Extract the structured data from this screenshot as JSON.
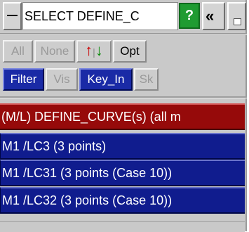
{
  "window": {
    "title": "SELECT DEFINE_C",
    "help_label": "?",
    "collapse_label": "«"
  },
  "row1": {
    "all_label": "All",
    "none_label": "None",
    "sort_up_label": "↑",
    "sort_down_label": "↓",
    "opt_label": "Opt"
  },
  "row2": {
    "filter_label": "Filter",
    "vis_label": "Vis",
    "key_in_label": "Key_In",
    "sk_label": "Sk"
  },
  "list": {
    "header": "(M/L) DEFINE_CURVE(s) (all m",
    "items": [
      "M1 /LC3 (3 points)",
      "M1 /LC31 (3 points (Case 10))",
      "M1 /LC32 (3 points (Case 10))"
    ]
  }
}
